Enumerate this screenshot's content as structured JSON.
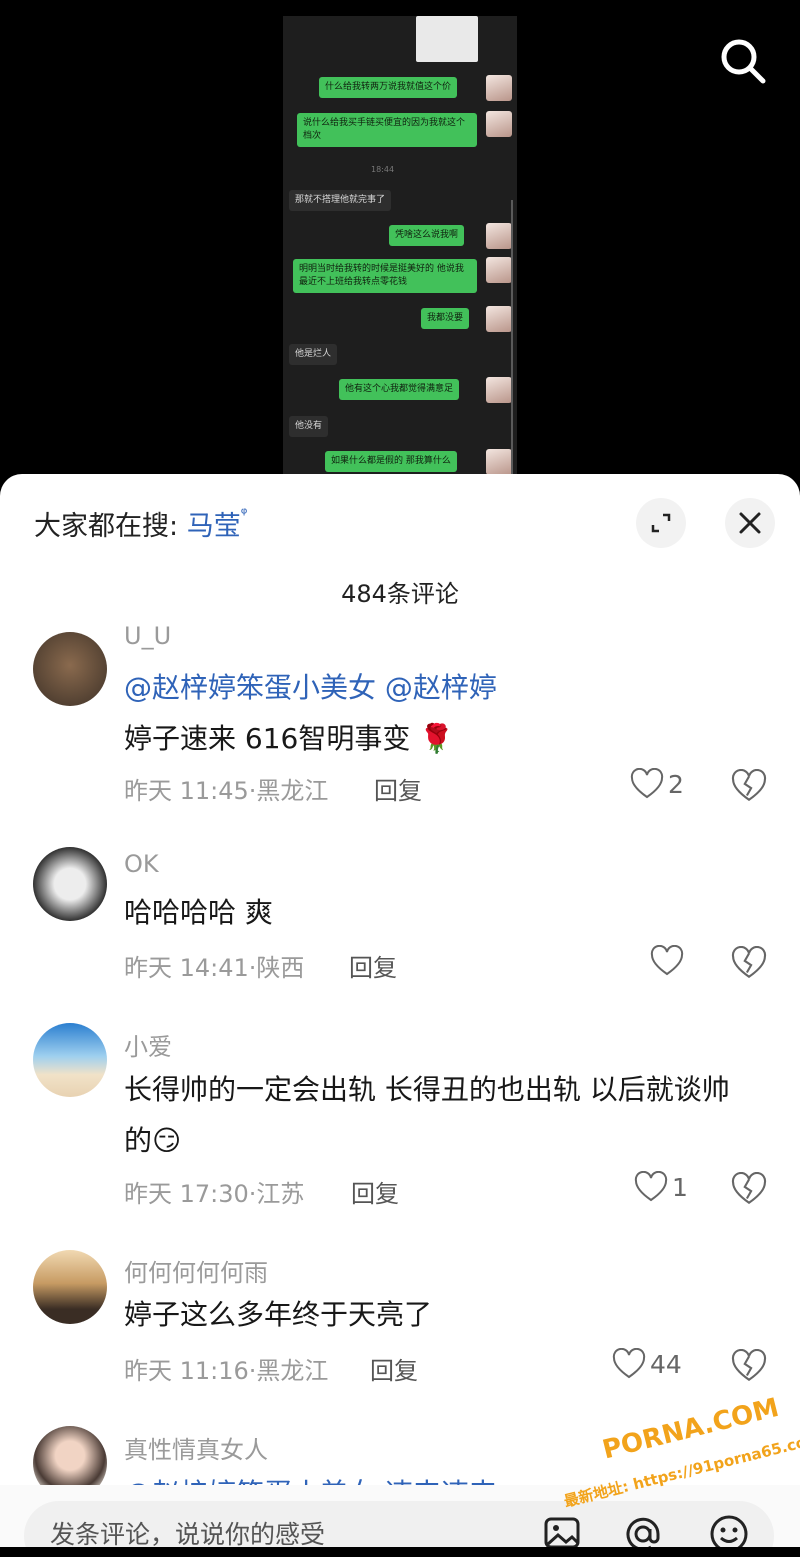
{
  "video": {
    "chat_time": "18:44",
    "messages": [
      {
        "side": "right",
        "text": "什么给我转两万说我就值这个价"
      },
      {
        "side": "right",
        "text": "说什么给我买手链买便宜的因为我就这个档次"
      },
      {
        "side": "left",
        "text": "那就不搭理他就完事了"
      },
      {
        "side": "right",
        "text": "凭啥这么说我啊"
      },
      {
        "side": "right",
        "text": "明明当时给我转的时候是挺美好的 他说我最近不上班给我转点零花钱"
      },
      {
        "side": "right",
        "text": "我都没要"
      },
      {
        "side": "left",
        "text": "他是烂人"
      },
      {
        "side": "right",
        "text": "他有这个心我都觉得满意足"
      },
      {
        "side": "left",
        "text": "他没有"
      },
      {
        "side": "right",
        "text": "如果什么都是假的 那我算什么"
      }
    ]
  },
  "icons": {
    "search": "search-icon",
    "expand": "expand-icon",
    "close": "close-icon",
    "like": "heart-icon",
    "dislike": "broken-heart-icon",
    "image": "image-icon",
    "mention": "at-icon",
    "emoji": "emoji-icon"
  },
  "sheet": {
    "hot_search_label": "大家都在搜:",
    "hot_search_keyword": "马莹",
    "hot_search_icon": "ᵠ",
    "comment_count": "484条评论"
  },
  "comments": [
    {
      "name": "U_U",
      "mention1": "@赵梓婷笨蛋小美女",
      "mention2": "@赵梓婷",
      "text": "婷子速来 616智明事变 🌹",
      "time": "昨天 11:45·黑龙江",
      "reply": "回复",
      "likes": "2"
    },
    {
      "name": "OK",
      "text": "哈哈哈哈 爽",
      "time": "昨天 14:41·陕西",
      "reply": "回复",
      "likes": ""
    },
    {
      "name": "小爱",
      "text": "长得帅的一定会出轨 长得丑的也出轨 以后就谈帅的😏",
      "time": "昨天 17:30·江苏",
      "reply": "回复",
      "likes": "1"
    },
    {
      "name": "何何何何何雨",
      "text": "婷子这么多年终于天亮了",
      "time": "昨天 11:16·黑龙江",
      "reply": "回复",
      "likes": "44"
    },
    {
      "name": "真性情真女人",
      "text": "@赵梓婷笨蛋小美女 速来速来",
      "time": "",
      "reply": "",
      "likes": ""
    }
  ],
  "input": {
    "placeholder": "发条评论，说说你的感受"
  },
  "watermark": {
    "line1": "PORNA.COM",
    "line2": "最新地址: https://91porna65.com"
  },
  "colors": {
    "accent": "#2f63b8",
    "bubble_green": "#42c15a",
    "watermark": "#f2a31b"
  }
}
